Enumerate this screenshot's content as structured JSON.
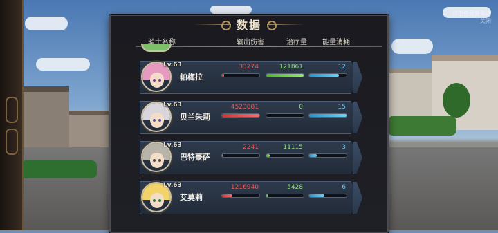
{
  "panel": {
    "title": "数据",
    "headers": {
      "knight": "骑士名称",
      "damage": "输出伤害",
      "heal": "治疗量",
      "energy": "能量消耗"
    }
  },
  "corner_text": "点击任意处关闭 关闭",
  "rows": [
    {
      "name": "帕梅拉",
      "level": "Lv.63",
      "damage": "33274",
      "heal": "121861",
      "energy": "12",
      "damage_frac": 0.06,
      "heal_frac": 1.0,
      "energy_frac": 0.8,
      "hair_color": "#e79ac0",
      "eye_color": "#7a3a8a"
    },
    {
      "name": "贝兰朱莉",
      "level": "Lv.63",
      "damage": "4523881",
      "heal": "0",
      "energy": "15",
      "damage_frac": 1.0,
      "heal_frac": 0.0,
      "energy_frac": 1.0,
      "hair_color": "#d8d6da",
      "eye_color": "#5a5a8a"
    },
    {
      "name": "巴特豪萨",
      "level": "Lv.63",
      "damage": "2241",
      "heal": "11115",
      "energy": "3",
      "damage_frac": 0.02,
      "heal_frac": 0.1,
      "energy_frac": 0.2,
      "hair_color": "#b8b4aa",
      "eye_color": "#4a4a4a"
    },
    {
      "name": "艾莫莉",
      "level": "Lv.63",
      "damage": "1216940",
      "heal": "5428",
      "energy": "6",
      "damage_frac": 0.27,
      "heal_frac": 0.05,
      "energy_frac": 0.4,
      "hair_color": "#f1d36a",
      "eye_color": "#3a7a3a"
    }
  ]
}
